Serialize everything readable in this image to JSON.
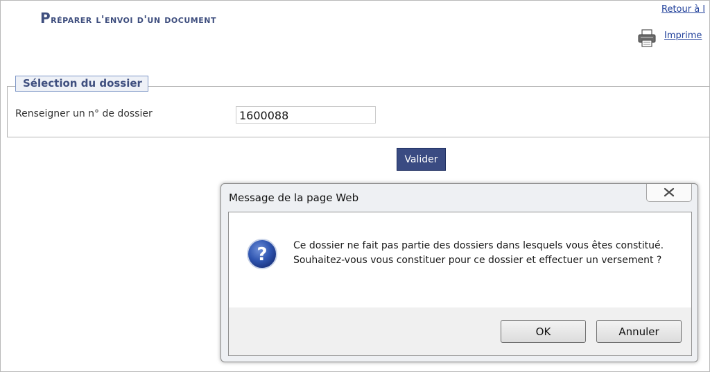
{
  "header": {
    "title_first": "P",
    "title_rest": "réparer l'envoi d'un document",
    "back_link": "Retour à l",
    "print_link": "Imprime",
    "print_icon": "printer-icon"
  },
  "selection": {
    "legend": "Sélection du dossier",
    "field_label": "Renseigner un n° de dossier",
    "dossier_value": "1600088",
    "submit_label": "Valider"
  },
  "dialog": {
    "title": "Message de la page Web",
    "close_icon": "close-icon",
    "icon": "question-icon",
    "message": "Ce dossier ne fait pas partie des dossiers dans lesquels vous êtes constitué. Souhaitez-vous vous constituer pour ce dossier et effectuer un versement ?",
    "ok_label": "OK",
    "cancel_label": "Annuler"
  },
  "colors": {
    "title": "#3e4e7e",
    "primary_button": "#3a4b82",
    "link": "#1f3f9a"
  }
}
